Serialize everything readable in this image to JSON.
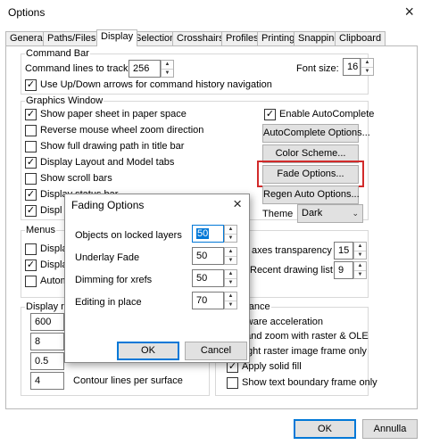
{
  "window": {
    "title": "Options",
    "close": "×"
  },
  "tabs": [
    "General",
    "Paths/Files",
    "Display",
    "Selection",
    "Crosshairs",
    "Profiles",
    "Printing",
    "Snapping",
    "Clipboard"
  ],
  "active_tab": "Display",
  "command_bar": {
    "title": "Command Bar",
    "lines_label": "Command lines to track:",
    "lines_value": "256",
    "font_size_label": "Font size:",
    "font_size_value": "16",
    "updown_label": "Use Up/Down arrows for command history navigation",
    "updown_checked": true
  },
  "graphics_window": {
    "title": "Graphics Window",
    "checks": [
      {
        "label": "Show paper sheet in paper space",
        "checked": true
      },
      {
        "label": "Reverse mouse wheel zoom direction",
        "checked": false
      },
      {
        "label": "Show full drawing path in title bar",
        "checked": false
      },
      {
        "label": "Display Layout and Model tabs",
        "checked": true
      },
      {
        "label": "Show scroll bars",
        "checked": false
      },
      {
        "label": "Display status bar",
        "checked": true
      },
      {
        "label": "Displ",
        "checked": true
      }
    ],
    "autocomplete_label": "Enable AutoComplete",
    "autocomplete_checked": true,
    "autocomplete_options_btn": "AutoComplete Options...",
    "color_scheme_btn": "Color Scheme...",
    "fade_options_btn": "Fade Options...",
    "regen_btn": "Regen Auto Options...",
    "theme_label": "Theme",
    "theme_value": "Dark"
  },
  "menus": {
    "title": "Menus",
    "checks": [
      {
        "label": "Displa",
        "checked": false
      },
      {
        "label": "Displa",
        "checked": true
      },
      {
        "label": "Autom",
        "checked": false
      }
    ],
    "transparency_label": "axes transparency (%):",
    "transparency_value": "15",
    "recent_label": "Recent drawing list size:",
    "recent_value": "9"
  },
  "display_resolution": {
    "title": "Display res",
    "values": [
      "600",
      "8",
      "0.5",
      "4"
    ],
    "contour_label": "Contour lines per surface"
  },
  "performance": {
    "title": "erformance",
    "items": [
      {
        "label": "rdware acceleration",
        "checked": null
      },
      {
        "label": "n and zoom with raster & OLE",
        "checked": null
      },
      {
        "label": "hlight raster image frame only",
        "checked": null
      },
      {
        "label": "Apply solid fill",
        "checked": true
      },
      {
        "label": "Show text boundary frame only",
        "checked": false
      }
    ]
  },
  "fading_dialog": {
    "title": "Fading Options",
    "close": "×",
    "rows": [
      {
        "label": "Objects on locked layers",
        "value": "50"
      },
      {
        "label": "Underlay Fade",
        "value": "50"
      },
      {
        "label": "Dimming for xrefs",
        "value": "50"
      },
      {
        "label": "Editing in place",
        "value": "70"
      }
    ],
    "ok": "OK",
    "cancel": "Cancel"
  },
  "footer": {
    "ok": "OK",
    "cancel": "Annulla"
  },
  "colors": {
    "accent": "#0078d7",
    "highlight": "#d22b2b"
  },
  "icons": {
    "check": "✓",
    "spin_up": "▲",
    "spin_down": "▼",
    "dropdown": "⌄"
  }
}
